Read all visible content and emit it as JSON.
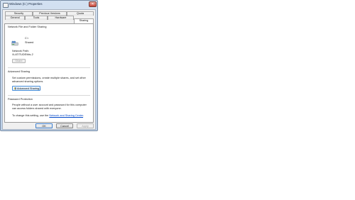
{
  "window": {
    "title": "Windows (C:) Properties",
    "close_glyph": "✕"
  },
  "tabs_row1": [
    {
      "label": "Security"
    },
    {
      "label": "Previous Versions"
    },
    {
      "label": "Quota"
    }
  ],
  "tabs_row2": [
    {
      "label": "General"
    },
    {
      "label": "Tools"
    },
    {
      "label": "Hardware"
    },
    {
      "label": "Sharing",
      "active": true
    }
  ],
  "network_sharing": {
    "heading": "Network File and Folder Sharing",
    "drive_name": "C:\\",
    "drive_status": "Shared",
    "path_label": "Network Path:",
    "path_value": "\\\\LATITUDE\\fds-2",
    "share_button": "Share",
    "drive_icon": "shared-drive-icon"
  },
  "advanced_sharing": {
    "heading": "Advanced Sharing",
    "description_line1": "Set custom permissions, create multiple shares, and set other",
    "description_line2": "advanced sharing options.",
    "button": "Advanced Sharing...",
    "button_icon": "uac-shield-icon"
  },
  "password_protection": {
    "heading": "Password Protection",
    "line1": "People without a user account and password for this computer",
    "line2": "can access folders shared with everyone.",
    "change_prefix": "To change this setting, use the ",
    "link": "Network and Sharing Center",
    "change_suffix": "."
  },
  "footer": {
    "ok": "OK",
    "cancel": "Cancel",
    "apply": "Apply"
  },
  "colors": {
    "accent_link": "#0046c8",
    "frame": "#bcd0e8",
    "close": "#c9463a"
  }
}
